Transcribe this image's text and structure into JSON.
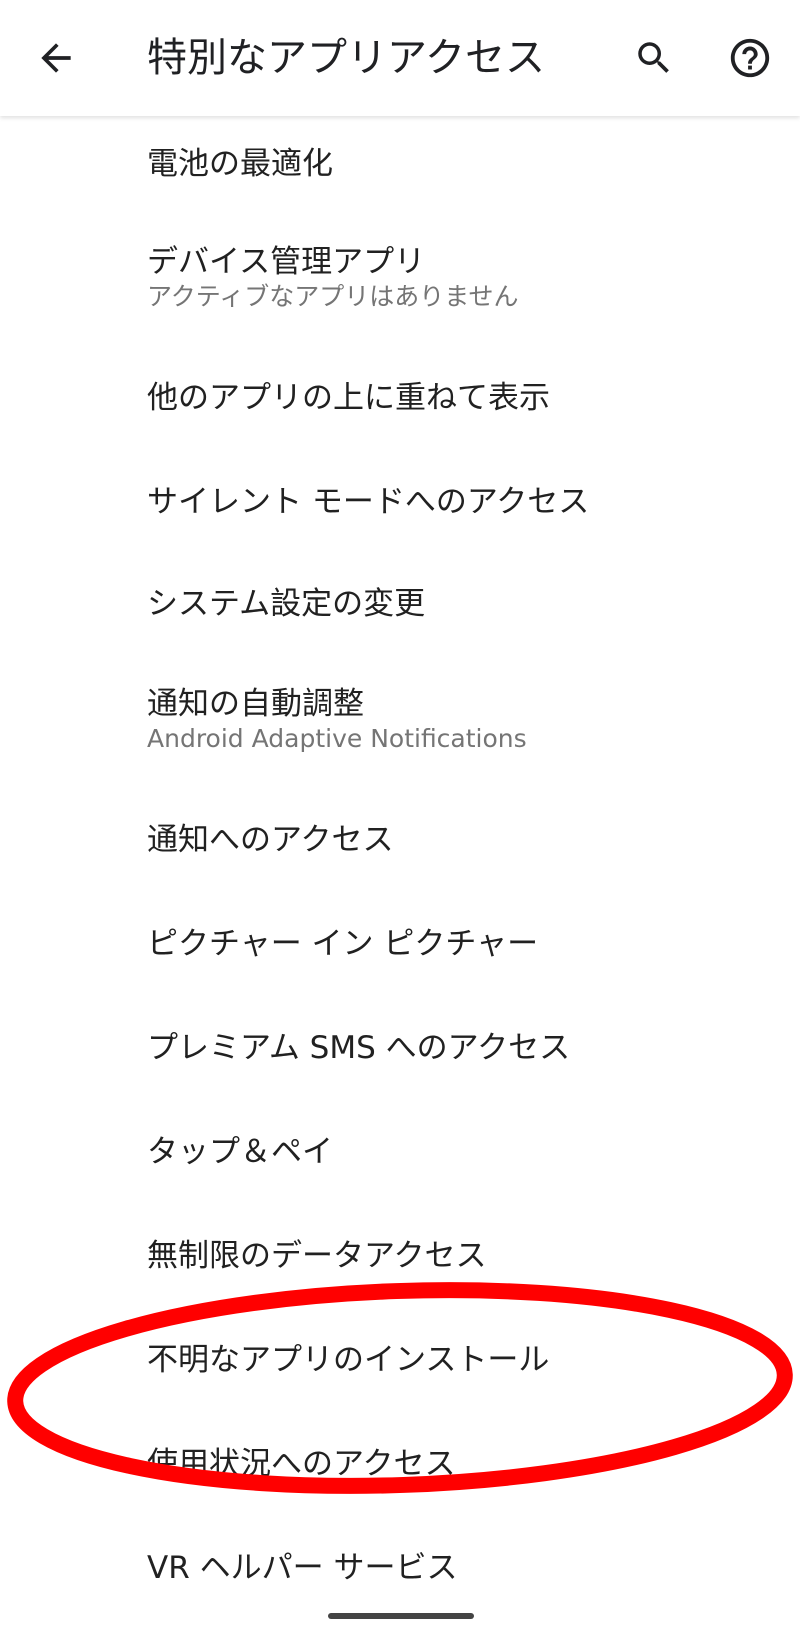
{
  "appbar": {
    "title": "特別なアプリアクセス",
    "back_icon": "arrow-back-icon",
    "search_icon": "search-icon",
    "help_icon": "help-circle-icon"
  },
  "list": {
    "items": [
      {
        "title": "電池の最適化",
        "subtitle": ""
      },
      {
        "title": "デバイス管理アプリ",
        "subtitle": "アクティブなアプリはありません"
      },
      {
        "title": "他のアプリの上に重ねて表示",
        "subtitle": ""
      },
      {
        "title": "サイレント モードへのアクセス",
        "subtitle": ""
      },
      {
        "title": "システム設定の変更",
        "subtitle": ""
      },
      {
        "title": "通知の自動調整",
        "subtitle": "Android Adaptive Notifications"
      },
      {
        "title": "通知へのアクセス",
        "subtitle": ""
      },
      {
        "title": "ピクチャー イン ピクチャー",
        "subtitle": ""
      },
      {
        "title": "プレミアム SMS へのアクセス",
        "subtitle": ""
      },
      {
        "title": "タップ＆ペイ",
        "subtitle": ""
      },
      {
        "title": "無制限のデータアクセス",
        "subtitle": ""
      },
      {
        "title": "不明なアプリのインストール",
        "subtitle": ""
      },
      {
        "title": "使用状況へのアクセス",
        "subtitle": ""
      },
      {
        "title": "VR ヘルパー サービス",
        "subtitle": ""
      }
    ]
  },
  "colors": {
    "annotation": "#ff0000",
    "text_primary": "#212121",
    "text_secondary": "#757575"
  }
}
